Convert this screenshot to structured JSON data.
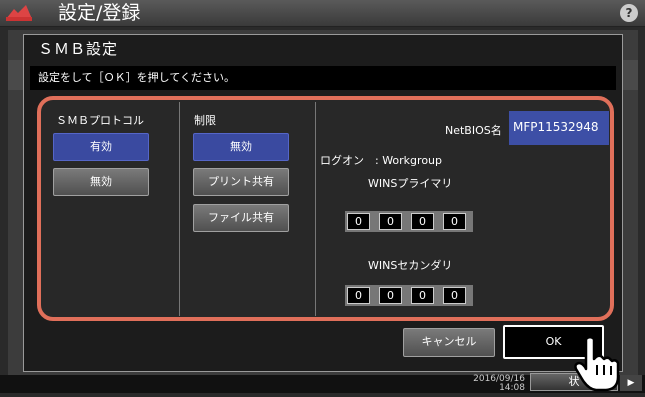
{
  "header": {
    "title": "設定/登録",
    "help_label": "?"
  },
  "dialog": {
    "title": "ＳＭＢ設定",
    "instruction": "設定をして［ＯＫ］を押してください。"
  },
  "smb_protocol": {
    "label": "ＳＭＢプロトコル",
    "options": [
      "有効",
      "無効"
    ],
    "selected": "有効"
  },
  "restriction": {
    "label": "制限",
    "options": [
      "無効",
      "プリント共有",
      "ファイル共有"
    ],
    "selected": "無効"
  },
  "netbios": {
    "label": "NetBIOS名",
    "value": "MFP11532948",
    "logon_text": "ログオン　: Workgroup"
  },
  "wins_primary": {
    "label": "WINSプライマリ",
    "octets": [
      "0",
      "0",
      "0",
      "0"
    ]
  },
  "wins_secondary": {
    "label": "WINSセカンダリ",
    "octets": [
      "0",
      "0",
      "0",
      "0"
    ]
  },
  "actions": {
    "cancel_label": "キャンセル",
    "ok_label": "OK"
  },
  "footer": {
    "date": "2016/09/16",
    "time": "14:08",
    "status_label": "状",
    "arrow": "▶"
  },
  "colors": {
    "accent": "#e06f5a",
    "active_button": "#3a4aa0"
  }
}
